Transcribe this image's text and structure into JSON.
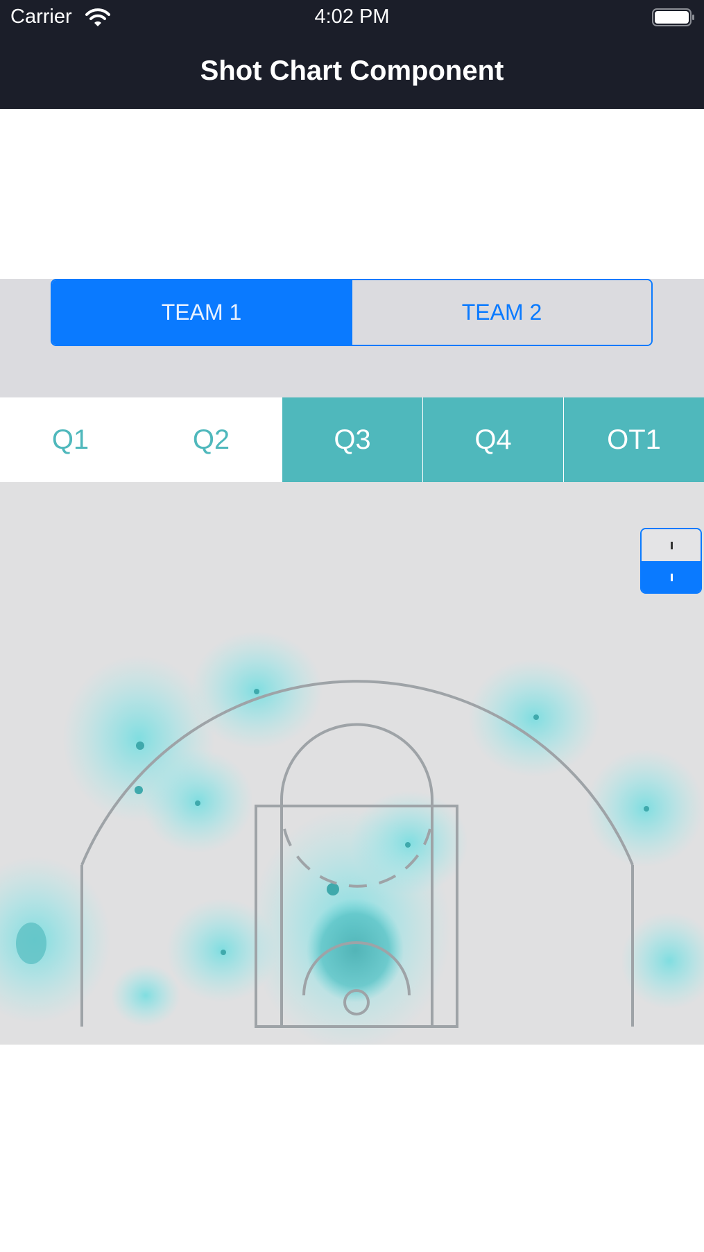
{
  "status_bar": {
    "carrier": "Carrier",
    "time": "4:02 PM",
    "wifi_icon": "wifi-icon",
    "battery_icon": "battery-icon"
  },
  "nav": {
    "title": "Shot Chart Component"
  },
  "team_selector": {
    "options": [
      "TEAM 1",
      "TEAM 2"
    ],
    "selected": "TEAM 1"
  },
  "period_filter": {
    "periods": [
      {
        "label": "Q1",
        "selected": false
      },
      {
        "label": "Q2",
        "selected": false
      },
      {
        "label": "Q3",
        "selected": true
      },
      {
        "label": "Q4",
        "selected": true
      },
      {
        "label": "OT1",
        "selected": true
      }
    ]
  },
  "view_toggle": {
    "selected_index": 1
  },
  "colors": {
    "header_bg": "#1b1e29",
    "accent_blue": "#0a7aff",
    "teal": "#4fb8bc",
    "heat": "#6fdde0",
    "court_bg": "#e0e0e1",
    "court_lines": "#9ea3a7"
  }
}
